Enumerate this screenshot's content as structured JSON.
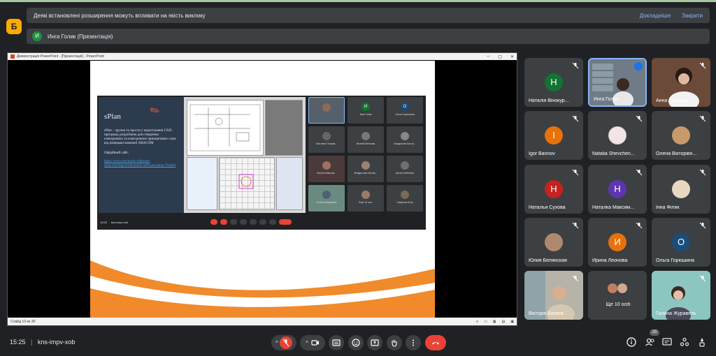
{
  "banner": {
    "text": "Деякі встановлені розширення можуть впливати на якість виклику",
    "more": "Докладніше",
    "close": "Закрити"
  },
  "app_badge": "Б",
  "presentation_bar": {
    "avatar": "И",
    "text": "Инга Голик (Презентація)"
  },
  "ppt": {
    "title": "Демонстрація PowerPoint - [Презентація] - PowerPoint",
    "status": "Слайд 10 из 30",
    "slide": {
      "heading": "sPlan",
      "description": "sPlan – зручна та проста у користуванні САD-програма, розроблена для створення електронних та електричних принципових схем від німецької компанії ABACOM",
      "site_label": "Офіційний сайт:",
      "site_url": "https://www.electronic-software-shop.com/lng/en/electronic-software/splan-70.html"
    },
    "inner_meet": {
      "time": "13:22",
      "code": "kns-impv-xob",
      "tiles": [
        "Інна Голик",
        "Ольга Горюшина",
        "Світлана Погрем...",
        "Віталій Мельник",
        "Владислав Бистр...",
        "Наталя Максим...",
        "Владислав Пронів...",
        "Артем Зайченко",
        "Галина Журавель",
        "Ещё 10 чел.",
        "Смирнов Егор"
      ]
    }
  },
  "participants": [
    {
      "name": "Наталія Вінокур...",
      "initial": "Н",
      "color": "#137333"
    },
    {
      "name": "Инга Голик",
      "initial": "",
      "color": ""
    },
    {
      "name": "Анна Сидорук",
      "initial": "",
      "color": ""
    },
    {
      "name": "Igor Barinov",
      "initial": "I",
      "color": "#e8710a"
    },
    {
      "name": "Natalia Shevchen...",
      "initial": "",
      "color": ""
    },
    {
      "name": "Олена Вікторівн...",
      "initial": "",
      "color": ""
    },
    {
      "name": "Наталья Сухова",
      "initial": "Н",
      "color": "#c5221f"
    },
    {
      "name": "Наталка Максим...",
      "initial": "Н",
      "color": "#5e35b1"
    },
    {
      "name": "Інна Філик",
      "initial": "",
      "color": ""
    },
    {
      "name": "Юлия Белянская",
      "initial": "",
      "color": ""
    },
    {
      "name": "Ирина Леонова",
      "initial": "И",
      "color": "#e8710a"
    },
    {
      "name": "Ольга Горюшина",
      "initial": "О",
      "color": "#1a4d7a"
    },
    {
      "name": "Вікторія Базенк...",
      "initial": "",
      "color": ""
    },
    {
      "name": "Ще 10 осіб",
      "initial": "",
      "color": ""
    },
    {
      "name": "Галина Журавель",
      "initial": "",
      "color": ""
    }
  ],
  "bottom": {
    "time": "15:25",
    "separator": "|",
    "code": "kns-impv-xob",
    "people_count": "25"
  }
}
